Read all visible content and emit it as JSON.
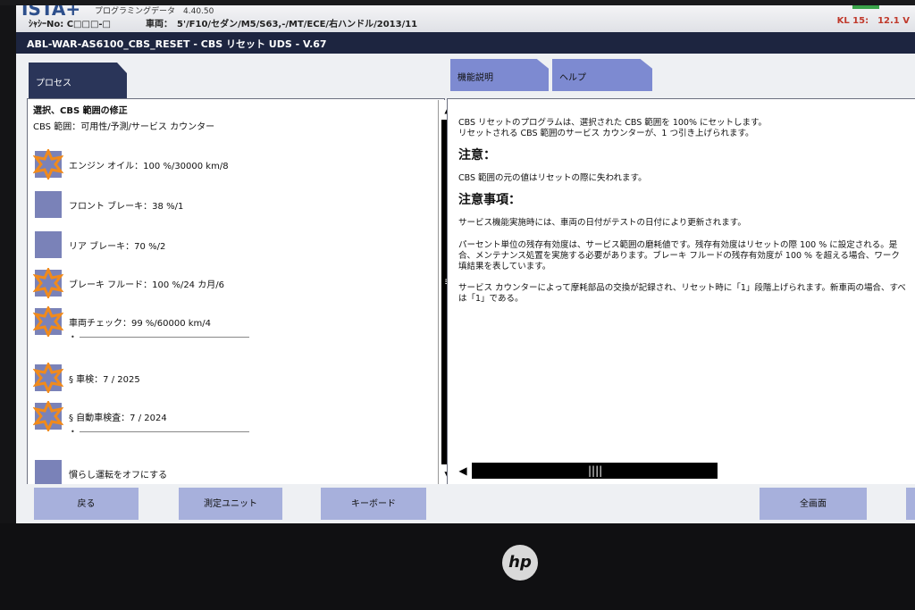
{
  "topbar": {
    "logo": "ISTA+",
    "program_data": "プログラミングデータ　4.40.50",
    "chassis": "ｼｬｼｰNo:  C□□□-□",
    "vehicle": "車両：　5'/F10/セダン/M5/S63,-/MT/ECE/右ハンドル/2013/11",
    "kl": "KL 15:　12.1 V"
  },
  "title": "ABL-WAR-AS6100_CBS_RESET - CBS リセット UDS - V.67",
  "tabs": {
    "process": "プロセス",
    "function": "機能説明",
    "help": "ヘルプ"
  },
  "left": {
    "heading": "選択、CBS 範囲の修正",
    "subheading": "CBS 範囲：可用性/予測/サービス カウンター",
    "items": [
      {
        "label": "エンジン オイル：100 %/30000 km/8",
        "icon": "star-icon",
        "sub": ""
      },
      {
        "label": "フロント ブレーキ：38 %/1",
        "icon": "blank-icon",
        "sub": ""
      },
      {
        "label": "リア ブレーキ：70 %/2",
        "icon": "blank-icon",
        "sub": ""
      },
      {
        "label": "ブレーキ フルード：100 %/24 カ月/6",
        "icon": "star-icon",
        "sub": ""
      },
      {
        "label": "車両チェック：99 %/60000 km/4",
        "icon": "star-icon",
        "sub": "•"
      },
      {
        "label": "§ 車検：7 / 2025",
        "icon": "star-icon",
        "sub": ""
      },
      {
        "label": "§ 自動車検査：7 / 2024",
        "icon": "star-icon",
        "sub": "•"
      },
      {
        "label": "慣らし運転をオフにする",
        "icon": "blank-icon",
        "sub": ""
      }
    ]
  },
  "right": {
    "p1": "CBS リセットのプログラムは、選択された CBS 範囲を 100% にセットします。",
    "p2": "リセットされる CBS 範囲のサービス カウンターが、1 つ引き上げられます。",
    "h1": "注意：",
    "p3": "CBS 範囲の元の値はリセットの際に失われます。",
    "h2": "注意事項：",
    "p4": "サービス機能実施時には、車両の日付がテストの日付により更新されます。",
    "p5": "パーセント単位の残存有効度は、サービス範囲の磨耗値です。残存有効度はリセットの際 100 % に設定される。是",
    "p6": "合、メンテナンス処置を実施する必要があります。ブレーキ フルードの残存有効度が 100 % を超える場合、ワーク",
    "p7": "填結果を表しています。",
    "p8": "サービス カウンターによって摩耗部品の交換が記録され、リセット時に「1」段階上げられます。新車両の場合、すべ",
    "p9": "は「1」である。"
  },
  "buttons": {
    "back": "戻る",
    "measure": "測定ユニット",
    "keyboard": "キーボード",
    "fullscreen": "全画面"
  },
  "brand": "hp",
  "colors": {
    "title_bg": "#1d2540",
    "tab": "#7d8ad1",
    "button": "#a7b0dc",
    "icon_bg": "#7a82b8",
    "star": "#f08a1c",
    "kl": "#c0392b"
  }
}
